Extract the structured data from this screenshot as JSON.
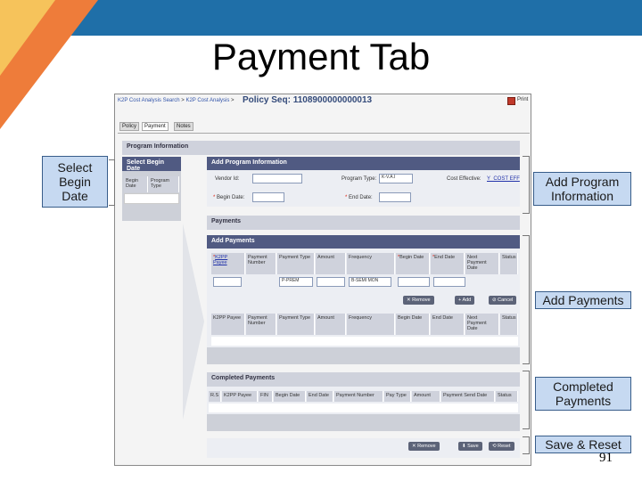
{
  "slide": {
    "title": "Payment Tab",
    "page_number": "91",
    "colors": {
      "bar": "#1f6fa8",
      "orange": "#ee7c3a",
      "yellow": "#f6c35b",
      "callout_fill": "#c6d9f1"
    }
  },
  "callouts": {
    "select_begin_date": "Select Begin Date",
    "add_program_info": "Add Program Information",
    "add_payments": "Add Payments",
    "completed_payments": "Completed Payments",
    "save_reset": "Save & Reset"
  },
  "app": {
    "breadcrumb": [
      "K2P Cost Analysis Search",
      "K2P Cost Analysis"
    ],
    "policy_seq_label": "Policy Seq:",
    "policy_seq_value": "1108900000000013",
    "print_label": "Print",
    "tabs": [
      "Policy",
      "Payment",
      "Notes"
    ],
    "program_information_header": "Program Information",
    "select_begin_date": {
      "header": "Select Begin Date",
      "columns": [
        "Begin Date",
        "Program Type"
      ]
    },
    "add_program_information": {
      "header": "Add Program Information",
      "vendor_id_label": "Vendor Id:",
      "program_type_label": "Program Type:",
      "program_type_value": "K-V.A.I",
      "cost_effective_label": "Cost Effective:",
      "cost_effective_value": "Y_COST EFF",
      "begin_date_label": "Begin Date:",
      "end_date_label": "End Date:"
    },
    "payments_header": "Payments",
    "add_payments": {
      "header": "Add Payments",
      "columns": [
        "K2PP Payee",
        "Payment Number",
        "Payment Type",
        "Amount",
        "Frequency",
        "Begin Date",
        "End Date",
        "Next Payment Date",
        "Status"
      ],
      "payment_type_value": "P-PREM",
      "frequency_value": "B-SEMI MON",
      "buttons": {
        "remove": "Remove",
        "add": "Add",
        "cancel": "Cancel"
      },
      "list_columns": [
        "K2PP Payee",
        "Payment Number",
        "Payment Type",
        "Amount",
        "Frequency",
        "Begin Date",
        "End Date",
        "Next Payment Date",
        "Status"
      ]
    },
    "completed_payments": {
      "header": "Completed Payments",
      "columns": [
        "R.S",
        "K2PP Payee",
        "FIN",
        "Begin Date",
        "End Date",
        "Payment Number",
        "Pay Type",
        "Amount",
        "Payment Send Date",
        "Status"
      ]
    },
    "footer_buttons": {
      "remove": "Remove",
      "save": "Save",
      "reset": "Reset"
    }
  }
}
